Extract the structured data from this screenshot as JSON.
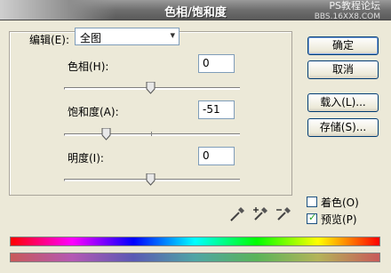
{
  "window": {
    "title": "色相/饱和度",
    "watermark_line1": "PS教程论坛",
    "watermark_line2": "BBS.16XX8.COM"
  },
  "edit": {
    "label": "编辑(E):",
    "value": "全图"
  },
  "sliders": {
    "hue": {
      "label": "色相(H):",
      "value": "0"
    },
    "saturation": {
      "label": "饱和度(A):",
      "value": "-51"
    },
    "lightness": {
      "label": "明度(I):",
      "value": "0"
    }
  },
  "buttons": {
    "ok": "确定",
    "cancel": "取消",
    "load": "载入(L)...",
    "save": "存储(S)..."
  },
  "checkboxes": {
    "colorize": {
      "label": "着色(O)",
      "checked": false
    },
    "preview": {
      "label": "预览(P)",
      "checked": true
    }
  },
  "icons": {
    "eyedropper": "eyedropper-icon",
    "eyedropper_add": "eyedropper-plus-icon",
    "eyedropper_subtract": "eyedropper-minus-icon",
    "dropdown": "chevron-down-icon"
  }
}
